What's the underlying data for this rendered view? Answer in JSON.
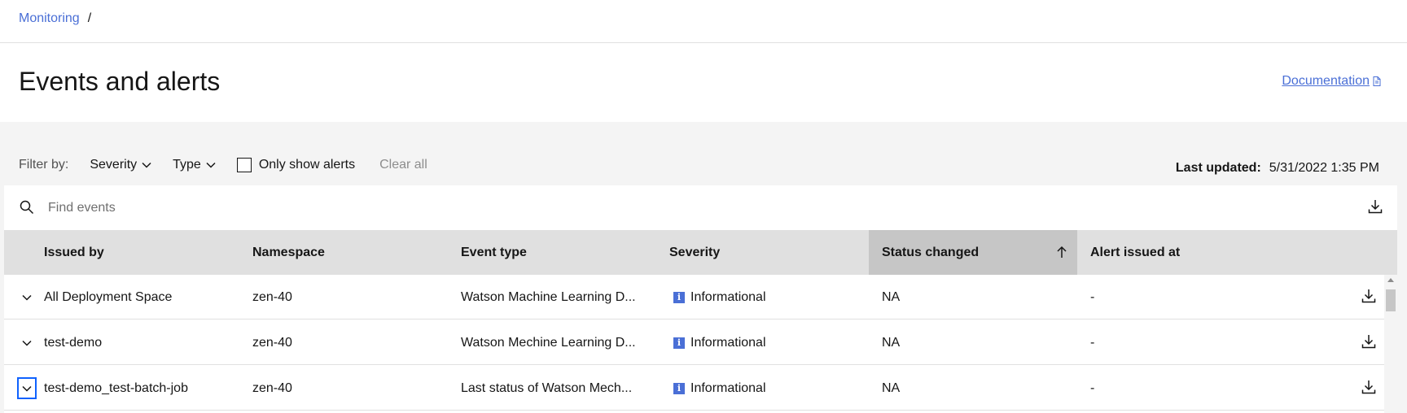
{
  "breadcrumb": {
    "link": "Monitoring",
    "separator": "/"
  },
  "page": {
    "title": "Events and alerts",
    "documentation_label": "Documentation"
  },
  "filters": {
    "label": "Filter by:",
    "severity_label": "Severity",
    "type_label": "Type",
    "only_alerts_label": "Only show alerts",
    "only_alerts_checked": false,
    "clear_all_label": "Clear all"
  },
  "last_updated": {
    "label": "Last updated:",
    "value": "5/31/2022 1:35 PM"
  },
  "search": {
    "placeholder": "Find events",
    "value": ""
  },
  "table": {
    "columns": [
      "Issued by",
      "Namespace",
      "Event type",
      "Severity",
      "Status changed",
      "Alert issued at"
    ],
    "sorted_column": "Status changed",
    "sort_direction": "ascending",
    "rows": [
      {
        "issued_by": "All Deployment Space",
        "namespace": "zen-40",
        "event_type": "Watson Machine Learning D...",
        "severity": "Informational",
        "status_changed": "NA",
        "alert_issued_at": "-"
      },
      {
        "issued_by": "test-demo",
        "namespace": "zen-40",
        "event_type": "Watson Mechine Learning D...",
        "severity": "Informational",
        "status_changed": "NA",
        "alert_issued_at": "-"
      },
      {
        "issued_by": "test-demo_test-batch-job",
        "namespace": "zen-40",
        "event_type": "Last status of Watson Mech...",
        "severity": "Informational",
        "status_changed": "NA",
        "alert_issued_at": "-"
      }
    ]
  },
  "colors": {
    "link": "#4a6fd6",
    "focus": "#0f62fe",
    "header_bg": "#e0e0e0",
    "sorted_header_bg": "#c6c6c6",
    "panel_bg": "#f4f4f4"
  },
  "icons": [
    "chevron-down-icon",
    "search-icon",
    "download-icon",
    "arrow-up-icon",
    "info-icon",
    "document-icon"
  ]
}
